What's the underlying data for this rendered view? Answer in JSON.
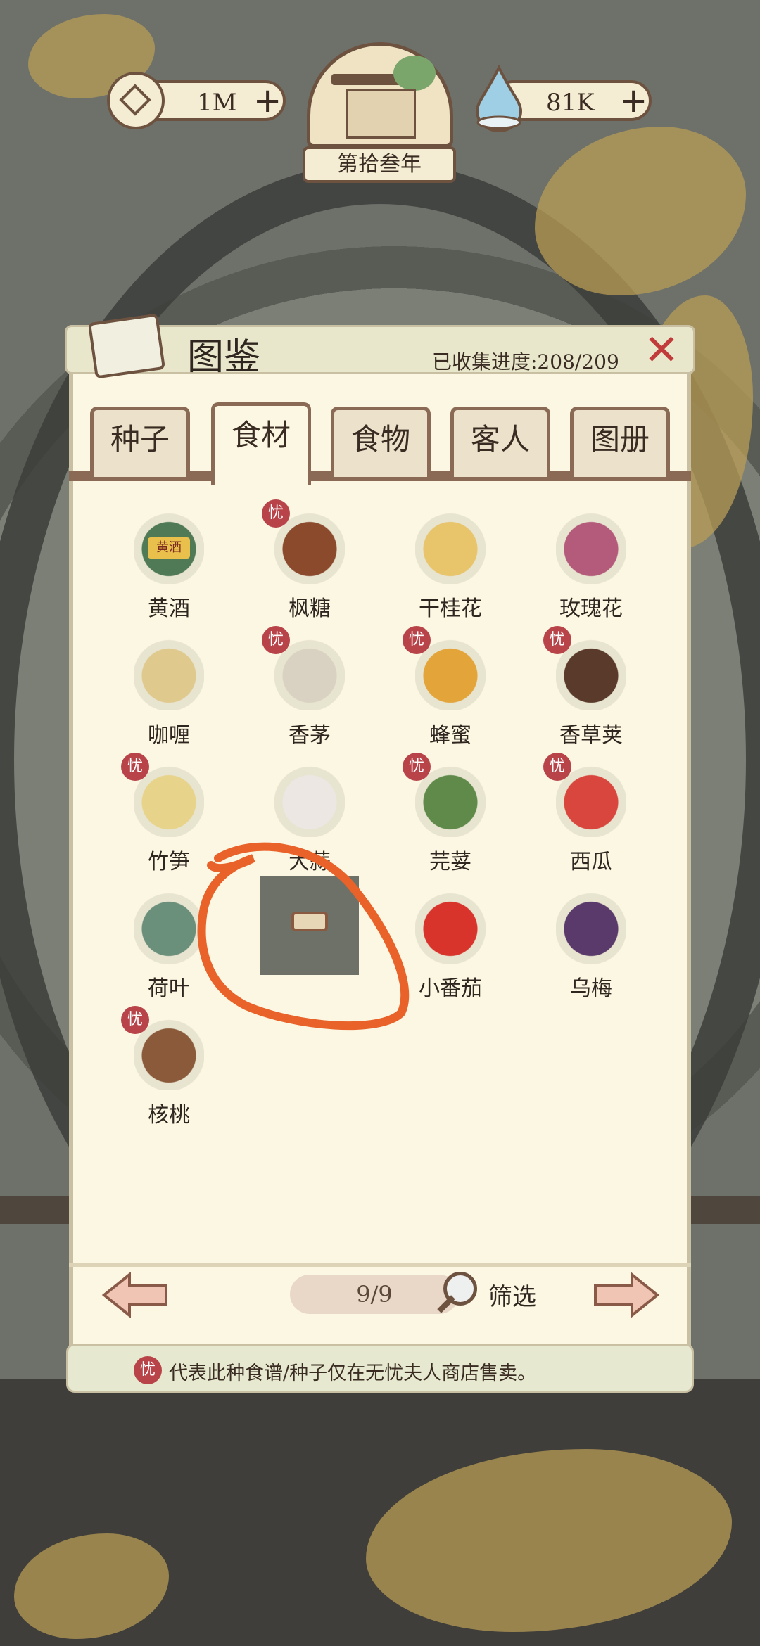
{
  "header": {
    "coins_value": "1M",
    "water_value": "81K",
    "year_label": "第拾叁年"
  },
  "panel": {
    "title": "图鉴",
    "progress_label": "已收集进度:208/209",
    "close_icon": "close-x-icon"
  },
  "tabs": [
    {
      "label": "种子",
      "active": false
    },
    {
      "label": "食材",
      "active": true
    },
    {
      "label": "食物",
      "active": false
    },
    {
      "label": "客人",
      "active": false
    },
    {
      "label": "图册",
      "active": false
    }
  ],
  "badge_glyph": "忧",
  "items": [
    {
      "name": "黄酒",
      "badge": false,
      "icon": "wine-jar-icon",
      "img_text": "黄酒"
    },
    {
      "name": "枫糖",
      "badge": true,
      "icon": "maple-sugar-icon"
    },
    {
      "name": "干桂花",
      "badge": false,
      "icon": "osmanthus-bowl-icon"
    },
    {
      "name": "玫瑰花",
      "badge": false,
      "icon": "rose-icon"
    },
    {
      "name": "咖喱",
      "badge": false,
      "icon": "curry-tray-icon"
    },
    {
      "name": "香茅",
      "badge": true,
      "icon": "lemongrass-icon"
    },
    {
      "name": "蜂蜜",
      "badge": true,
      "icon": "honey-jar-icon"
    },
    {
      "name": "香草荚",
      "badge": true,
      "icon": "vanilla-pod-icon"
    },
    {
      "name": "竹笋",
      "badge": true,
      "icon": "bamboo-shoot-icon"
    },
    {
      "name": "大蒜",
      "badge": false,
      "icon": "garlic-icon"
    },
    {
      "name": "芫荽",
      "badge": true,
      "icon": "coriander-icon"
    },
    {
      "name": "西瓜",
      "badge": true,
      "icon": "watermelon-icon"
    },
    {
      "name": "荷叶",
      "badge": false,
      "icon": "lotus-leaf-icon"
    },
    {
      "name": "",
      "badge": false,
      "icon": "redacted-item-icon"
    },
    {
      "name": "小番茄",
      "badge": false,
      "icon": "cherry-tomato-icon"
    },
    {
      "name": "乌梅",
      "badge": false,
      "icon": "plum-icon"
    },
    {
      "name": "核桃",
      "badge": true,
      "icon": "walnut-icon"
    }
  ],
  "footer": {
    "page_indicator": "9/9",
    "filter_label": "筛选",
    "prev_icon": "arrow-left-icon",
    "next_icon": "arrow-right-icon"
  },
  "notice": {
    "text": "代表此种食谱/种子仅在无忧夫人商店售卖。"
  },
  "colors": {
    "accent_red": "#c23b3b",
    "badge_red": "#b8444a",
    "annotation_orange": "#e8622a",
    "panel_bg": "#fbf7e2",
    "border_brown": "#8a6a55"
  }
}
